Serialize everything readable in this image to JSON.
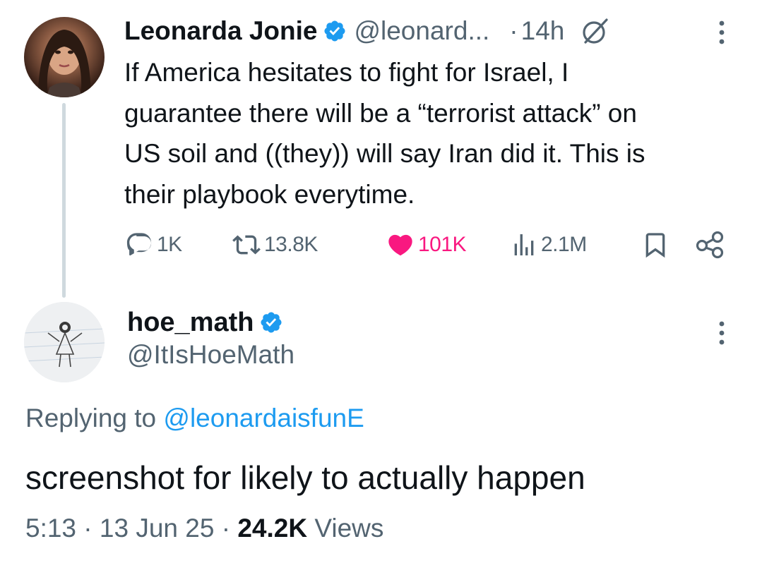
{
  "parent_tweet": {
    "display_name": "Leonarda Jonie",
    "handle": "@leonard...",
    "separator": "·",
    "time": "14h",
    "text_lines": [
      "If America hesitates to fight for Israel, I",
      "guarantee there will be a “terrorist attack” on",
      "US soil and ((they)) will say Iran did it. This is",
      "their playbook everytime."
    ],
    "replies": "1K",
    "retweets": "13.8K",
    "likes": "101K",
    "views": "2.1M",
    "liked": true
  },
  "reply_tweet": {
    "display_name": "hoe_math",
    "handle": "@ItIsHoeMath",
    "replying_prefix": "Replying to",
    "replying_to": "@leonardaisfunE",
    "text": "screenshot for likely to actually happen",
    "time": "5:13",
    "date": "13 Jun 25",
    "separator": "·",
    "views_count": "24.2K",
    "views_label": "Views"
  },
  "icons": {
    "verified": "verified-badge-icon",
    "grok": "grok-icon",
    "more": "more-vertical-icon",
    "reply": "reply-bubble-icon",
    "retweet": "retweet-icon",
    "like": "heart-icon",
    "views": "views-bar-chart-icon",
    "bookmark": "bookmark-icon",
    "share": "share-icon"
  },
  "colors": {
    "text_primary": "#0f1419",
    "text_secondary": "#536471",
    "accent_blue": "#1d9bf0",
    "like_pink": "#f91880",
    "thread_line": "#cfd9de"
  }
}
